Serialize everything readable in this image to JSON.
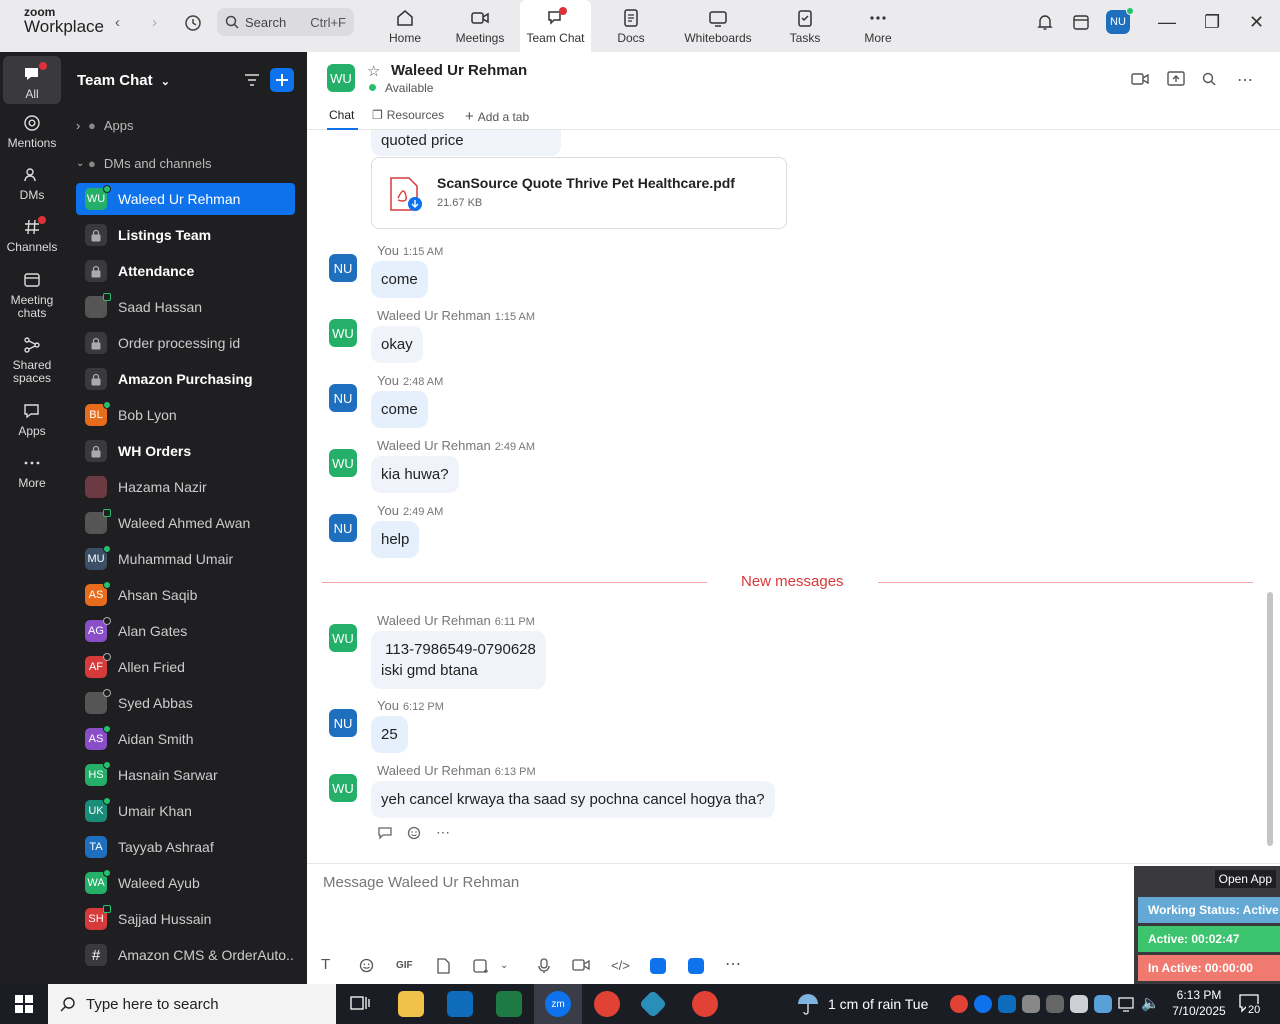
{
  "app": {
    "brand_top": "zoom",
    "brand_bottom": "Workplace"
  },
  "search": {
    "label": "Search",
    "shortcut": "Ctrl+F"
  },
  "top_tabs": [
    {
      "label": "Home"
    },
    {
      "label": "Meetings"
    },
    {
      "label": "Team Chat"
    },
    {
      "label": "Docs"
    },
    {
      "label": "Whiteboards"
    },
    {
      "label": "Tasks"
    },
    {
      "label": "More"
    }
  ],
  "user_avatar": "NU",
  "rail": [
    {
      "label": "All"
    },
    {
      "label": "Mentions"
    },
    {
      "label": "DMs"
    },
    {
      "label": "Channels"
    },
    {
      "label": "Meeting chats"
    },
    {
      "label": "Shared spaces"
    },
    {
      "label": "Apps"
    },
    {
      "label": "More"
    }
  ],
  "sidebar": {
    "title": "Team Chat",
    "sections": {
      "apps": "Apps",
      "dms": "DMs and channels"
    },
    "items": [
      {
        "label": "Waleed Ur Rehman",
        "initials": "WU",
        "color": "#25b06a"
      },
      {
        "label": "Listings Team",
        "initials": "",
        "color": "#3a3a3e"
      },
      {
        "label": "Attendance",
        "initials": "",
        "color": "#3a3a3e"
      },
      {
        "label": "Saad Hassan",
        "initials": "",
        "color": "#555"
      },
      {
        "label": "Order processing id",
        "initials": "",
        "color": "#3a3a3e"
      },
      {
        "label": "Amazon Purchasing",
        "initials": "",
        "color": "#3a3a3e"
      },
      {
        "label": "Bob Lyon",
        "initials": "BL",
        "color": "#e76d1c"
      },
      {
        "label": "WH Orders",
        "initials": "",
        "color": "#3a3a3e"
      },
      {
        "label": "Hazama Nazir",
        "initials": "",
        "color": "#6b3a42"
      },
      {
        "label": "Waleed Ahmed Awan",
        "initials": "",
        "color": "#555"
      },
      {
        "label": "Muhammad Umair",
        "initials": "MU",
        "color": "#3b4f66"
      },
      {
        "label": "Ahsan Saqib",
        "initials": "AS",
        "color": "#e76d1c"
      },
      {
        "label": "Alan Gates",
        "initials": "AG",
        "color": "#8a4fc8"
      },
      {
        "label": "Allen Fried",
        "initials": "AF",
        "color": "#d63a3a"
      },
      {
        "label": "Syed Abbas",
        "initials": "",
        "color": "#555"
      },
      {
        "label": "Aidan Smith",
        "initials": "AS",
        "color": "#8a4fc8"
      },
      {
        "label": "Hasnain Sarwar",
        "initials": "HS",
        "color": "#25b06a"
      },
      {
        "label": "Umair Khan",
        "initials": "UK",
        "color": "#1a8c7a"
      },
      {
        "label": "Tayyab Ashraaf",
        "initials": "TA",
        "color": "#1f6fbf"
      },
      {
        "label": "Waleed Ayub",
        "initials": "WA",
        "color": "#25b06a"
      },
      {
        "label": "Sajjad Hussain",
        "initials": "SH",
        "color": "#d63a3a"
      },
      {
        "label": "Amazon CMS & OrderAuto...",
        "initials": "#",
        "color": "#3a3a3e"
      }
    ]
  },
  "chat": {
    "contact": "Waleed Ur Rehman",
    "contact_initials": "WU",
    "status": "Available",
    "tabs": {
      "chat": "Chat",
      "resources": "Resources",
      "add": "Add a tab"
    },
    "partial_text": "quoted price",
    "file": {
      "name": "ScanSource Quote Thrive Pet Healthcare.pdf",
      "size": "21.67 KB"
    },
    "messages": [
      {
        "sender": "You",
        "time": "1:15 AM",
        "text": "come",
        "initials": "NU"
      },
      {
        "sender": "Waleed Ur Rehman",
        "time": "1:15 AM",
        "text": "okay",
        "initials": "WU"
      },
      {
        "sender": "You",
        "time": "2:48 AM",
        "text": "come",
        "initials": "NU"
      },
      {
        "sender": "Waleed Ur Rehman",
        "time": "2:49 AM",
        "text": "kia huwa?",
        "initials": "WU"
      },
      {
        "sender": "You",
        "time": "2:49 AM",
        "text": "help",
        "initials": "NU"
      },
      {
        "sender": "Waleed Ur Rehman",
        "time": "6:11 PM",
        "text": " 113-7986549-0790628",
        "text2": "iski gmd btana",
        "initials": "WU"
      },
      {
        "sender": "You",
        "time": "6:12 PM",
        "text": "25",
        "initials": "NU"
      },
      {
        "sender": "Waleed Ur Rehman",
        "time": "6:13 PM",
        "text": "yeh cancel krwaya tha saad sy pochna cancel hogya tha?",
        "initials": "WU"
      }
    ],
    "new_messages": "New messages",
    "composer_placeholder": "Message Waleed Ur Rehman",
    "gif": "GIF"
  },
  "work_status": {
    "open_app": "Open App",
    "working": "Working Status: Active",
    "active": "Active: 00:02:47",
    "inactive": "In Active: 00:00:00"
  },
  "taskbar": {
    "search_placeholder": "Type here to search",
    "weather": "1 cm of rain Tue",
    "time": "6:13 PM",
    "date": "7/10/2025",
    "notif_count": "20"
  },
  "colors": {
    "accent": "#0e72ed",
    "available": "#25c26e",
    "wu": "#25b06a",
    "nu": "#1f6fbf"
  }
}
